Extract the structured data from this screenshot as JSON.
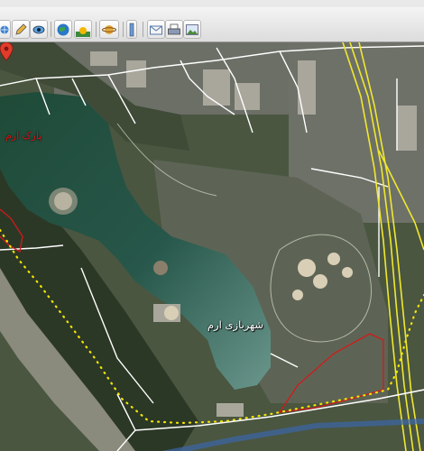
{
  "toolbar": {
    "buttons": [
      {
        "name": "globe-add-button",
        "icon": "globe-add-icon"
      },
      {
        "name": "pencil-button",
        "icon": "pencil-icon"
      },
      {
        "name": "eye-button",
        "icon": "eye-icon"
      },
      {
        "name": "earth-button",
        "icon": "earth-icon"
      },
      {
        "name": "sun-button",
        "icon": "sun-icon"
      },
      {
        "name": "planet-button",
        "icon": "planet-icon"
      },
      {
        "name": "ruler-button",
        "icon": "ruler-icon"
      },
      {
        "name": "email-button",
        "icon": "envelope-icon"
      },
      {
        "name": "print-button",
        "icon": "printer-icon"
      },
      {
        "name": "save-image-button",
        "icon": "image-icon"
      }
    ]
  },
  "map": {
    "labels": {
      "park": "پارک ارم",
      "amusement_park": "شهربازی ارم"
    },
    "colors": {
      "park_label": "#e11010",
      "path_dots": "#f2e600",
      "boundary": "#d21a1a",
      "road": "#ffffff",
      "highway": "#f0e830"
    }
  }
}
